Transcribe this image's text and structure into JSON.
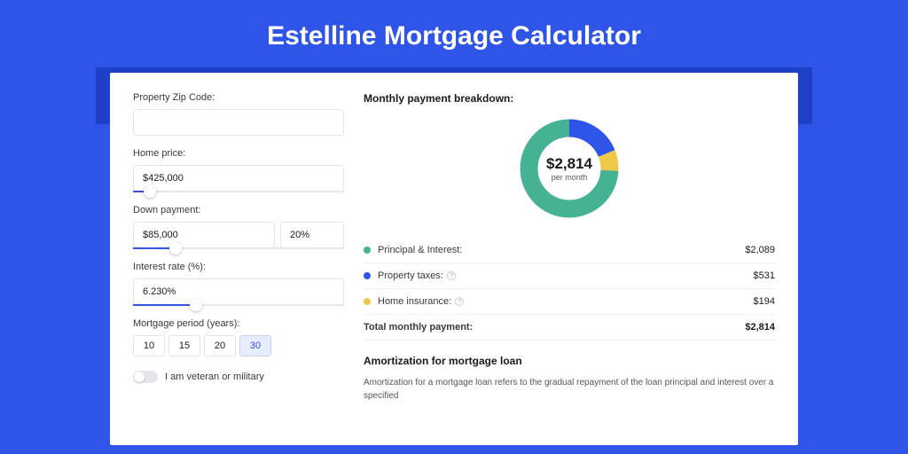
{
  "title": "Estelline Mortgage Calculator",
  "form": {
    "zip_label": "Property Zip Code:",
    "zip_value": "",
    "home_price_label": "Home price:",
    "home_price_value": "$425,000",
    "home_price_slider_pct": 8,
    "down_payment_label": "Down payment:",
    "down_payment_value": "$85,000",
    "down_payment_pct_value": "20%",
    "down_payment_slider_pct": 20,
    "interest_label": "Interest rate (%):",
    "interest_value": "6.230%",
    "interest_slider_pct": 30,
    "period_label": "Mortgage period (years):",
    "periods": [
      "10",
      "15",
      "20",
      "30"
    ],
    "period_selected_index": 3,
    "vet_label": "I am veteran or military"
  },
  "breakdown": {
    "title": "Monthly payment breakdown:",
    "center_amount": "$2,814",
    "center_sub": "per month",
    "segments": [
      {
        "key": "principal_interest",
        "label": "Principal & Interest:",
        "value": "$2,089",
        "numeric": 2089,
        "color": "#45b393"
      },
      {
        "key": "property_taxes",
        "label": "Property taxes:",
        "value": "$531",
        "numeric": 531,
        "color": "#2e54e8",
        "info": true
      },
      {
        "key": "home_insurance",
        "label": "Home insurance:",
        "value": "$194",
        "numeric": 194,
        "color": "#f0c94b",
        "info": true
      }
    ],
    "total_label": "Total monthly payment:",
    "total_value": "$2,814"
  },
  "amortization": {
    "title": "Amortization for mortgage loan",
    "text": "Amortization for a mortgage loan refers to the gradual repayment of the loan principal and interest over a specified"
  },
  "chart_data": {
    "type": "pie",
    "title": "Monthly payment breakdown",
    "categories": [
      "Principal & Interest",
      "Property taxes",
      "Home insurance"
    ],
    "values": [
      2089,
      531,
      194
    ],
    "colors": [
      "#45b393",
      "#2e54e8",
      "#f0c94b"
    ],
    "total": 2814,
    "center_label": "$2,814 per month"
  }
}
